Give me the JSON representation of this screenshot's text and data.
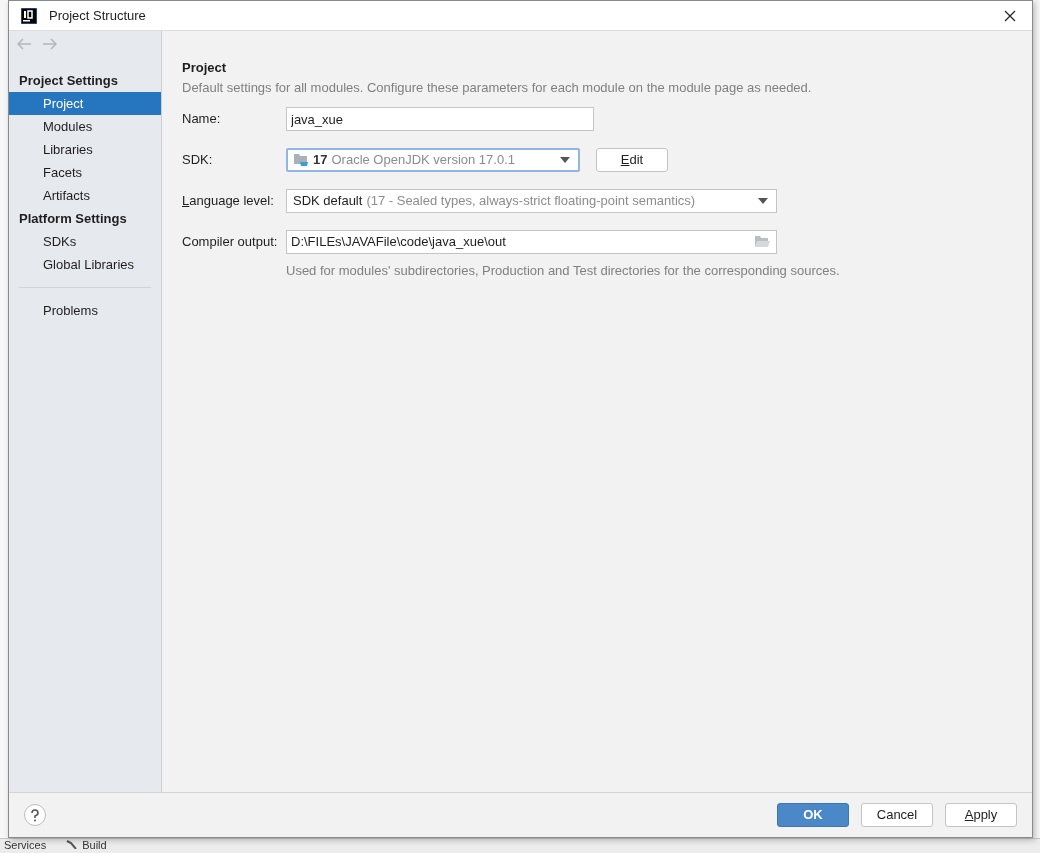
{
  "window": {
    "title": "Project Structure"
  },
  "sidebar": {
    "sections": [
      {
        "heading": "Project Settings",
        "items": [
          {
            "label": "Project",
            "selected": true
          },
          {
            "label": "Modules",
            "selected": false
          },
          {
            "label": "Libraries",
            "selected": false
          },
          {
            "label": "Facets",
            "selected": false
          },
          {
            "label": "Artifacts",
            "selected": false
          }
        ]
      },
      {
        "heading": "Platform Settings",
        "items": [
          {
            "label": "SDKs",
            "selected": false
          },
          {
            "label": "Global Libraries",
            "selected": false
          }
        ]
      },
      {
        "items": [
          {
            "label": "Problems",
            "selected": false
          }
        ]
      }
    ]
  },
  "panel": {
    "title": "Project",
    "description": "Default settings for all modules. Configure these parameters for each module on the module page as needed.",
    "fields": [
      {
        "kind": "text",
        "label": "Name:",
        "underline_first": false,
        "value": "java_xue"
      },
      {
        "kind": "sdk",
        "label": "SDK:",
        "underline_first": false,
        "value": "17",
        "detail": "Oracle OpenJDK version 17.0.1",
        "focused": true,
        "button": {
          "label": "Edit",
          "underline_first": true
        }
      },
      {
        "kind": "combo",
        "label": "Language level:",
        "underline_first": true,
        "value": "SDK default",
        "detail": "(17 - Sealed types, always-strict floating-point semantics)",
        "focused": false
      },
      {
        "kind": "path",
        "label": "Compiler output:",
        "underline_first": false,
        "value": "D:\\FILEs\\JAVAFile\\code\\java_xue\\out",
        "hint": "Used for modules' subdirectories, Production and Test directories for the corresponding sources."
      }
    ]
  },
  "footer": {
    "buttons": [
      {
        "label": "OK",
        "primary": true,
        "underline_first": false
      },
      {
        "label": "Cancel",
        "primary": false,
        "underline_first": false
      },
      {
        "label": "Apply",
        "primary": false,
        "underline_first": true
      }
    ]
  },
  "background_tool_tabs": [
    {
      "label": "Services",
      "kind": "plain"
    },
    {
      "label": "Build",
      "kind": "build"
    }
  ]
}
